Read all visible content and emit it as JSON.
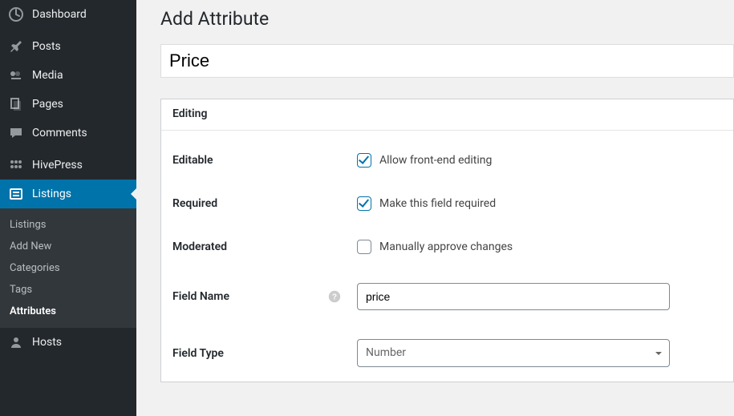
{
  "sidebar": {
    "items": [
      {
        "label": "Dashboard"
      },
      {
        "label": "Posts"
      },
      {
        "label": "Media"
      },
      {
        "label": "Pages"
      },
      {
        "label": "Comments"
      },
      {
        "label": "HivePress"
      },
      {
        "label": "Listings"
      },
      {
        "label": "Hosts"
      }
    ],
    "submenu": [
      {
        "label": "Listings"
      },
      {
        "label": "Add New"
      },
      {
        "label": "Categories"
      },
      {
        "label": "Tags"
      },
      {
        "label": "Attributes"
      }
    ]
  },
  "page": {
    "title": "Add Attribute",
    "name_value": "Price"
  },
  "panel": {
    "title": "Editing",
    "rows": {
      "editable": {
        "label": "Editable",
        "check_label": "Allow front-end editing",
        "checked": true
      },
      "required": {
        "label": "Required",
        "check_label": "Make this field required",
        "checked": true
      },
      "moderated": {
        "label": "Moderated",
        "check_label": "Manually approve changes",
        "checked": false
      },
      "field_name": {
        "label": "Field Name",
        "value": "price"
      },
      "field_type": {
        "label": "Field Type",
        "value": "Number"
      }
    }
  }
}
